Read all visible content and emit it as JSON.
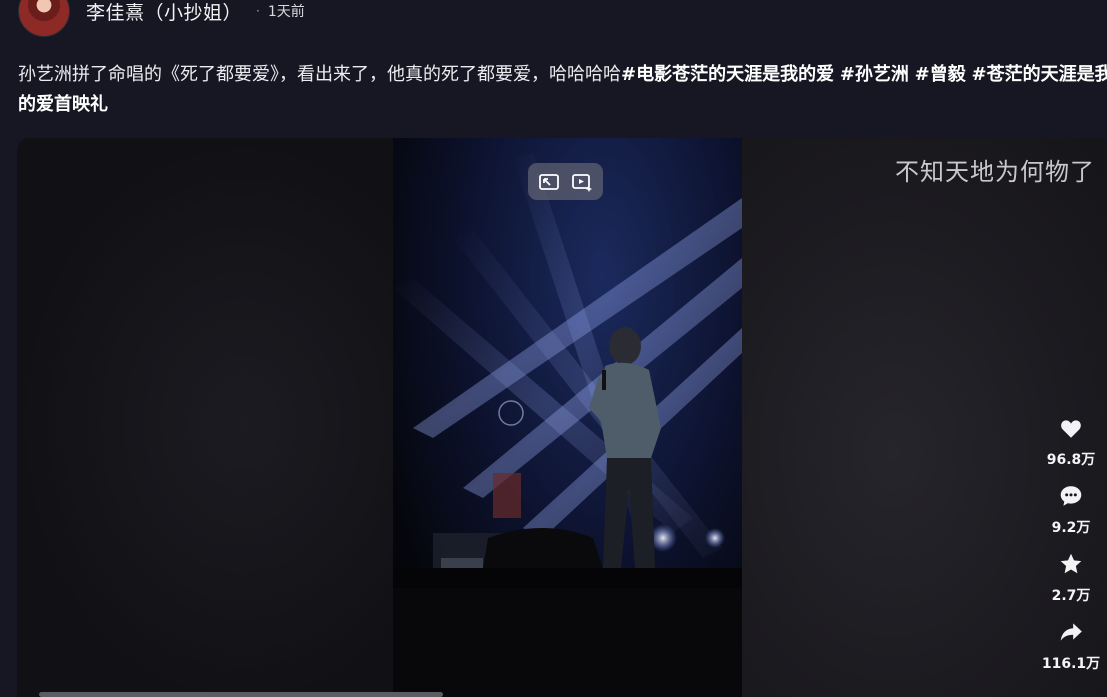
{
  "post": {
    "author": "李佳熹（小抄姐）",
    "separator": "·",
    "time": "1天前"
  },
  "caption": {
    "text": "孙艺洲拼了命唱的《死了都要爱》，看出来了，他真的死了都要爱，哈哈哈哈",
    "tags": [
      "#电影苍茫的天涯是我的爱",
      "#孙艺洲",
      "#曾毅",
      "#苍茫的天涯是我的爱首映礼"
    ]
  },
  "video": {
    "overlay_text": "不知天地为何物了",
    "controls": [
      {
        "name": "pip-icon"
      },
      {
        "name": "ai-play-icon"
      }
    ]
  },
  "actions": {
    "like": {
      "icon": "heart-icon",
      "count": "96.8万"
    },
    "comment": {
      "icon": "comment-icon",
      "count": "9.2万"
    },
    "favorite": {
      "icon": "star-icon",
      "count": "2.7万"
    },
    "share": {
      "icon": "share-icon",
      "count": "116.1万"
    }
  },
  "colors": {
    "background": "#161722",
    "text": "#ececf0",
    "accent": "#ffffff"
  }
}
